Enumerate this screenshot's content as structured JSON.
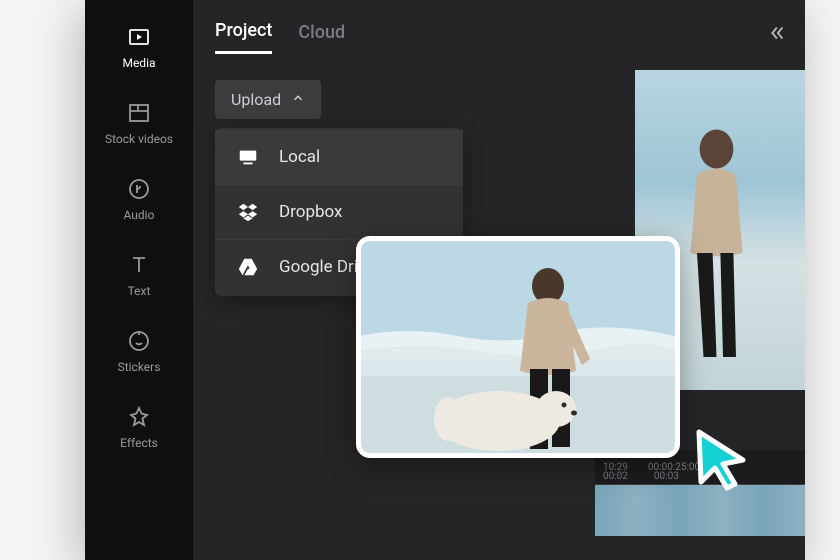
{
  "sidebar": {
    "items": [
      {
        "label": "Media",
        "icon": "media-icon"
      },
      {
        "label": "Stock videos",
        "icon": "stock-videos-icon"
      },
      {
        "label": "Audio",
        "icon": "audio-icon"
      },
      {
        "label": "Text",
        "icon": "text-icon"
      },
      {
        "label": "Stickers",
        "icon": "stickers-icon"
      },
      {
        "label": "Effects",
        "icon": "effects-icon"
      }
    ]
  },
  "tabs": {
    "project": "Project",
    "cloud": "Cloud"
  },
  "upload": {
    "label": "Upload",
    "menu": [
      {
        "label": "Local",
        "icon": "local-icon"
      },
      {
        "label": "Dropbox",
        "icon": "dropbox-icon"
      },
      {
        "label": "Google Drive",
        "icon": "google-drive-icon"
      }
    ]
  },
  "timeline": {
    "ticks_top": [
      "10:29",
      "00:00:25:00"
    ],
    "ticks_bottom": [
      "00:02",
      "00:03"
    ]
  },
  "colors": {
    "bg_dark": "#1a1a1a",
    "panel": "#252527",
    "accent_cursor": "#15d1d6"
  }
}
